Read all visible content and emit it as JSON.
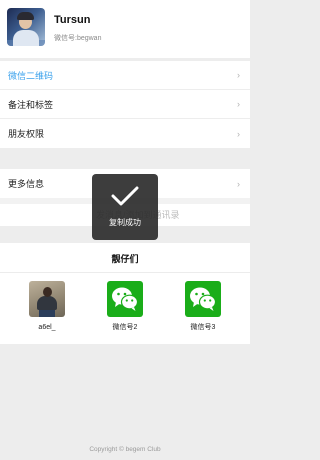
{
  "profile": {
    "nickname": "Tursun",
    "wechat_id": "微信号:begwan",
    "avatar_icon": "avatar-photo"
  },
  "menu": {
    "items": [
      {
        "label": "微信二维码",
        "active": true
      },
      {
        "label": "备注和标签"
      },
      {
        "label": "朋友权限"
      }
    ],
    "chevron": "›"
  },
  "menu2": {
    "items": [
      {
        "label": "更多信息"
      }
    ],
    "hidden_label": "发消息/添加到通讯录"
  },
  "group": {
    "title": "靓仔们",
    "members": [
      {
        "name": "a6el_",
        "avatar": "photo"
      },
      {
        "name": "微信号2",
        "avatar": "wechat-icon"
      },
      {
        "name": "微信号3",
        "avatar": "wechat-icon"
      }
    ]
  },
  "toast": {
    "text": "复制成功",
    "icon": "checkmark-icon"
  },
  "footer": {
    "text": "Copyright © begem Club"
  },
  "colors": {
    "accent": "#3aa1ec",
    "wechat_green": "#1aad19",
    "background": "#ededed"
  }
}
